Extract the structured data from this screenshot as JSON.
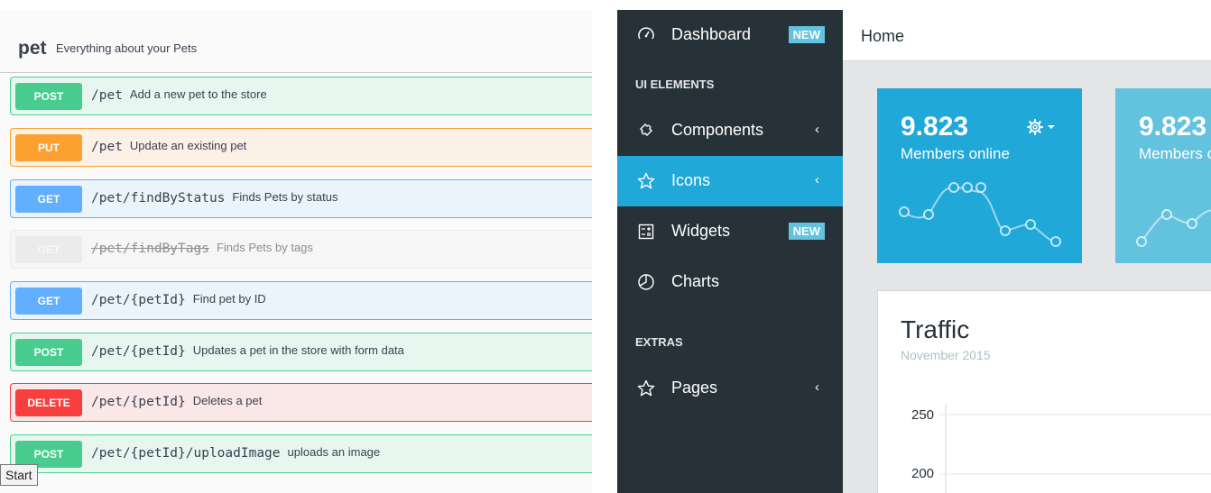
{
  "swagger": {
    "tag": {
      "name": "pet",
      "description": "Everything about your Pets"
    },
    "operations": [
      {
        "method": "POST",
        "kind": "post",
        "path": "/pet",
        "summary": "Add a new pet to the store"
      },
      {
        "method": "PUT",
        "kind": "put",
        "path": "/pet",
        "summary": "Update an existing pet"
      },
      {
        "method": "GET",
        "kind": "get",
        "path": "/pet/findByStatus",
        "summary": "Finds Pets by status"
      },
      {
        "method": "GET",
        "kind": "deprecated",
        "path": "/pet/findByTags",
        "summary": "Finds Pets by tags"
      },
      {
        "method": "GET",
        "kind": "get",
        "path": "/pet/{petId}",
        "summary": "Find pet by ID"
      },
      {
        "method": "POST",
        "kind": "post",
        "path": "/pet/{petId}",
        "summary": "Updates a pet in the store with form data"
      },
      {
        "method": "DELETE",
        "kind": "delete",
        "path": "/pet/{petId}",
        "summary": "Deletes a pet"
      },
      {
        "method": "POST",
        "kind": "post",
        "path": "/pet/{petId}/uploadImage",
        "summary": "uploads an image"
      }
    ],
    "tooltip": "Start"
  },
  "admin": {
    "sidebar": {
      "items": [
        {
          "label": "Dashboard",
          "icon": "speedometer-icon",
          "badge": "NEW"
        },
        {
          "label": "Components",
          "icon": "puzzle-icon",
          "chevron": "‹"
        },
        {
          "label": "Icons",
          "icon": "star-icon",
          "chevron": "‹",
          "active": true
        },
        {
          "label": "Widgets",
          "icon": "calculator-icon",
          "badge": "NEW"
        },
        {
          "label": "Charts",
          "icon": "pie-chart-icon"
        },
        {
          "label": "Pages",
          "icon": "star-icon",
          "chevron": "‹"
        }
      ],
      "titles": [
        "UI ELEMENTS",
        "EXTRAS"
      ]
    },
    "header": {
      "link": "Home"
    },
    "stat_cards": [
      {
        "value": "9.823",
        "label": "Members online",
        "color": "#20a8d8"
      },
      {
        "value": "9.823",
        "label": "Members online",
        "color": "#63c2de"
      }
    ],
    "traffic": {
      "title": "Traffic",
      "subtitle": "November 2015",
      "y_ticks": [
        "250",
        "200"
      ]
    }
  },
  "colors": {
    "sidebar_bg": "#263238",
    "accent": "#20a8d8",
    "badge": "#63c2de"
  }
}
